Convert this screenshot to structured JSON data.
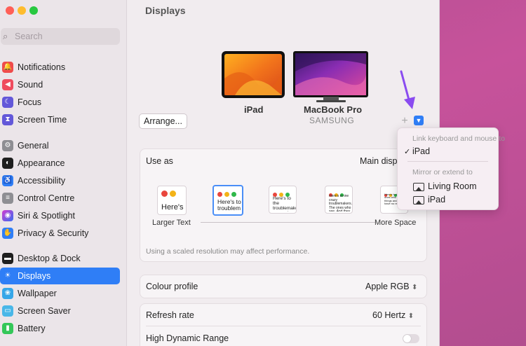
{
  "sidebar": {
    "search_placeholder": "Search",
    "items": [
      {
        "label": "Notifications",
        "icon": "bell-icon",
        "color": "#ef4b4b"
      },
      {
        "label": "Sound",
        "icon": "speaker-icon",
        "color": "#ef4b5e"
      },
      {
        "label": "Focus",
        "icon": "moon-icon",
        "color": "#6358d9"
      },
      {
        "label": "Screen Time",
        "icon": "hourglass-icon",
        "color": "#6358d9"
      },
      {
        "label": "General",
        "icon": "gear-icon",
        "color": "#8e8e93"
      },
      {
        "label": "Appearance",
        "icon": "appearance-icon",
        "color": "#1e1e1e"
      },
      {
        "label": "Accessibility",
        "icon": "accessibility-icon",
        "color": "#2f7ef6"
      },
      {
        "label": "Control Centre",
        "icon": "switches-icon",
        "color": "#8e8e93"
      },
      {
        "label": "Siri & Spotlight",
        "icon": "siri-icon",
        "color": "#9b4bd6"
      },
      {
        "label": "Privacy & Security",
        "icon": "hand-icon",
        "color": "#2f7ef6"
      },
      {
        "label": "Desktop & Dock",
        "icon": "dock-icon",
        "color": "#1e1e1e"
      },
      {
        "label": "Displays",
        "icon": "sun-icon",
        "color": "#2f7ef6"
      },
      {
        "label": "Wallpaper",
        "icon": "flower-icon",
        "color": "#36a6e8"
      },
      {
        "label": "Screen Saver",
        "icon": "screensaver-icon",
        "color": "#49b7e8"
      },
      {
        "label": "Battery",
        "icon": "battery-icon",
        "color": "#34c759"
      }
    ]
  },
  "content": {
    "title": "Displays",
    "arrange_label": "Arrange...",
    "displays": [
      {
        "name": "iPad",
        "sub": ""
      },
      {
        "name": "MacBook Pro",
        "sub": "SAMSUNG"
      }
    ],
    "plus_label": "+",
    "use_as": {
      "label": "Use as",
      "value": "Main displ"
    },
    "scale_options": [
      {
        "preview": "Here's",
        "caption": "Larger Text"
      },
      {
        "preview": "Here's to troublem",
        "caption": ""
      },
      {
        "preview": "Here's to the troublemakers. ones who",
        "caption": ""
      },
      {
        "preview": "Here's to the crazy troublemakers. The ones who see. And they",
        "caption": ""
      },
      {
        "preview": "Here's to the crazy ones who see things and they have no respect",
        "caption": "More Space"
      }
    ],
    "scale_note": "Using a scaled resolution may affect performance.",
    "colour_profile": {
      "label": "Colour profile",
      "value": "Apple RGB"
    },
    "refresh_rate": {
      "label": "Refresh rate",
      "value": "60 Hertz"
    },
    "hdr": {
      "label": "High Dynamic Range"
    }
  },
  "menu": {
    "header1": "Link keyboard and mouse to",
    "item_ipad_link": "iPad",
    "header2": "Mirror or extend to",
    "item_living_room": "Living Room",
    "item_ipad_mirror": "iPad"
  },
  "colors": {
    "accent": "#2f7ef6",
    "arrow": "#8a4bf0"
  }
}
